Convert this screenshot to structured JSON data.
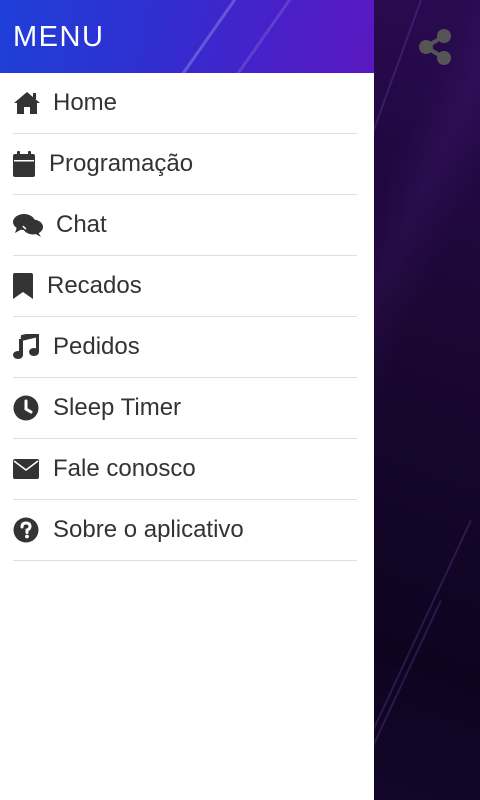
{
  "drawer": {
    "title": "MENU",
    "items": [
      {
        "label": "Home",
        "icon": "home-icon"
      },
      {
        "label": "Programação",
        "icon": "calendar-icon"
      },
      {
        "label": "Chat",
        "icon": "chat-icon"
      },
      {
        "label": "Recados",
        "icon": "bookmark-icon"
      },
      {
        "label": "Pedidos",
        "icon": "music-note-icon"
      },
      {
        "label": "Sleep Timer",
        "icon": "clock-icon"
      },
      {
        "label": "Fale conosco",
        "icon": "envelope-icon"
      },
      {
        "label": "Sobre o aplicativo",
        "icon": "question-circle-icon"
      }
    ]
  },
  "share": {
    "icon": "share-icon"
  },
  "colors": {
    "header_start": "#1f3fd9",
    "header_end": "#5a18c0",
    "backdrop": "#140622",
    "icon": "#333333",
    "share_icon": "#555555"
  }
}
